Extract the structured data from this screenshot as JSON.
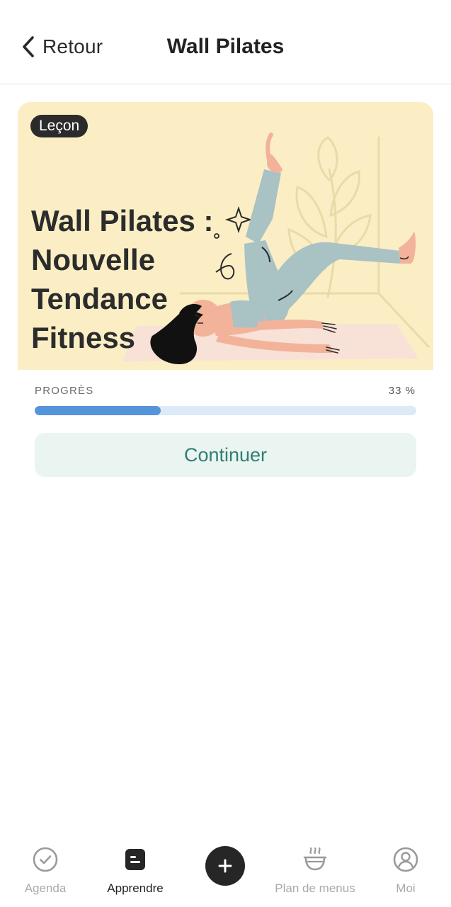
{
  "header": {
    "back_label": "Retour",
    "title": "Wall Pilates"
  },
  "hero": {
    "badge": "Leçon",
    "title_lines": [
      "Wall Pilates :",
      "Nouvelle",
      "Tendance",
      "Fitness"
    ],
    "background_color": "#fbeec5"
  },
  "progress": {
    "label": "PROGRÈS",
    "value_text": "33 %",
    "fraction": 0.33,
    "fill_color": "#5694d9",
    "track_color": "#dce9f7"
  },
  "continue_button": {
    "label": "Continuer"
  },
  "nav": {
    "items": [
      {
        "label": "Agenda",
        "icon": "check-circle-icon",
        "active": false
      },
      {
        "label": "Apprendre",
        "icon": "document-icon",
        "active": true
      },
      {
        "label": "",
        "icon": "plus-icon",
        "active": false
      },
      {
        "label": "Plan de menus",
        "icon": "bowl-icon",
        "active": false
      },
      {
        "label": "Moi",
        "icon": "user-circle-icon",
        "active": false
      }
    ]
  }
}
